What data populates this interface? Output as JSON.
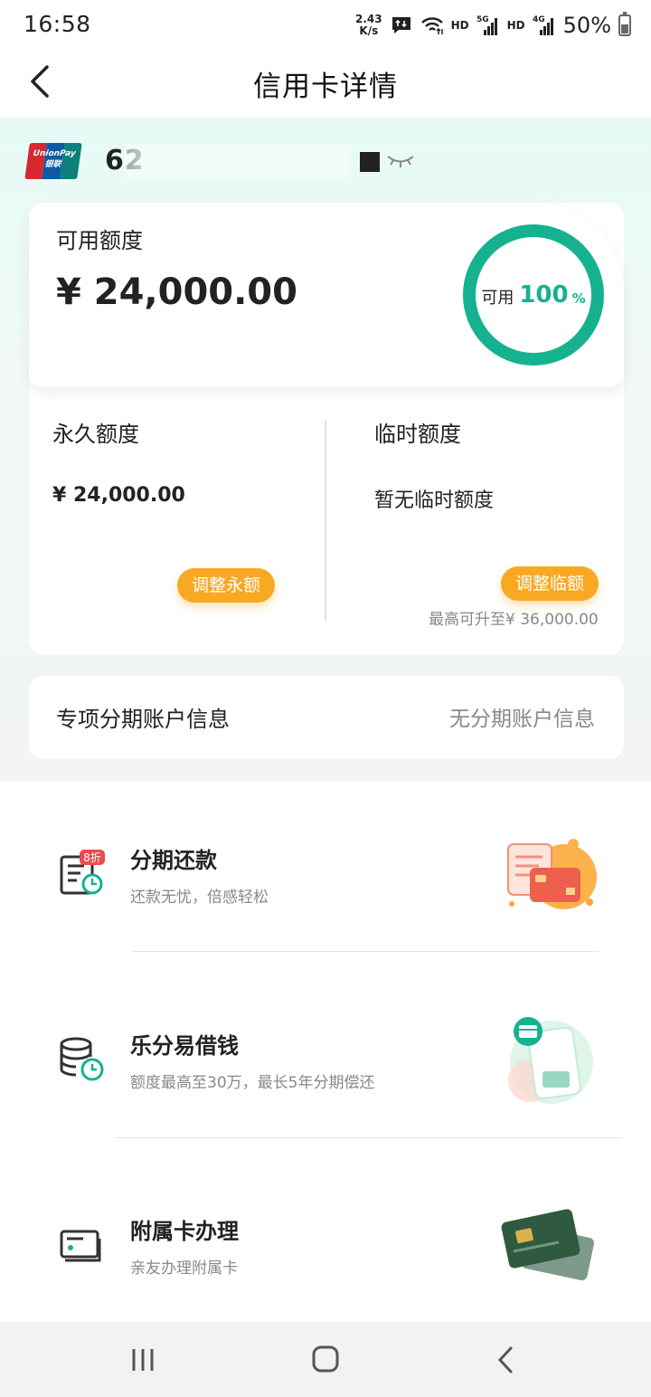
{
  "status_bar": {
    "time": "16:58",
    "net_speed_value": "2.43",
    "net_speed_unit": "K/s",
    "hd1": "HD",
    "hd2": "HD",
    "sig1_label": "5G",
    "sig2_label": "4G",
    "battery": "50%"
  },
  "header": {
    "title": "信用卡详情",
    "back_icon": "chevron-left-icon"
  },
  "card": {
    "number_prefix": "62",
    "brand": "UnionPay",
    "brand_cn": "银联",
    "eye_icon": "eye-closed-icon"
  },
  "credit": {
    "available_label": "可用额度",
    "available_amount": "¥ 24,000.00",
    "ring_label": "可用",
    "ring_percent": "100",
    "ring_percent_value": 100,
    "ring_unit": "%",
    "ring_color": "#16b28f",
    "permanent_title": "永久额度",
    "permanent_value": "¥ 24,000.00",
    "permanent_button": "调整永额",
    "temporary_title": "临时额度",
    "temporary_value": "暂无临时额度",
    "temporary_button": "调整临额",
    "max_note": "最高可升至¥ 36,000.00",
    "button_color": "#f9a824"
  },
  "special": {
    "label": "专项分期账户信息",
    "value": "无分期账户信息"
  },
  "services": [
    {
      "title": "分期还款",
      "subtitle": "还款无忧，倍感轻松",
      "badge": "8折",
      "icon": "installment-bill-icon"
    },
    {
      "title": "乐分易借钱",
      "subtitle": "额度最高至30万，最长5年分期偿还",
      "icon": "coin-stack-clock-icon"
    },
    {
      "title": "附属卡办理",
      "subtitle": "亲友办理附属卡",
      "icon": "card-icon"
    }
  ],
  "nav": {
    "recent": "recent-apps-icon",
    "home": "home-icon",
    "back": "back-icon"
  }
}
